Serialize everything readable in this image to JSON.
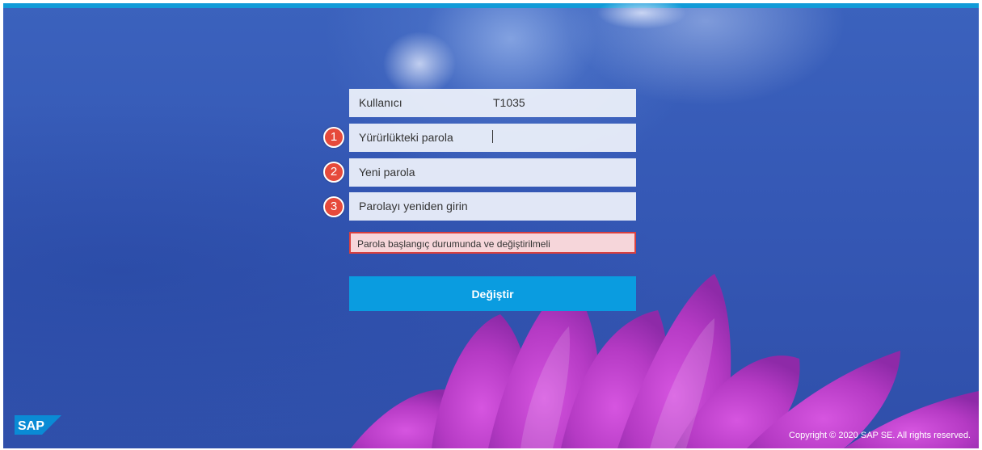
{
  "form": {
    "user_label": "Kullanıcı",
    "user_value": "T1035",
    "current_password_label": "Yürürlükteki parola",
    "new_password_label": "Yeni parola",
    "repeat_password_label": "Parolayı yeniden girin",
    "error_message": "Parola başlangıç durumunda ve değiştirilmeli",
    "submit_label": "Değiştir"
  },
  "annotations": [
    "1",
    "2",
    "3"
  ],
  "footer": {
    "logo_text": "SAP",
    "copyright": "Copyright © 2020 SAP SE. All rights reserved."
  },
  "colors": {
    "accent": "#0a9ce0",
    "topbar": "#119bd8",
    "background": "#3558b5",
    "error_border": "#d84040",
    "error_background": "#f6d6da",
    "badge": "#e64a3b"
  },
  "icons": [
    "sap-logo-icon"
  ]
}
